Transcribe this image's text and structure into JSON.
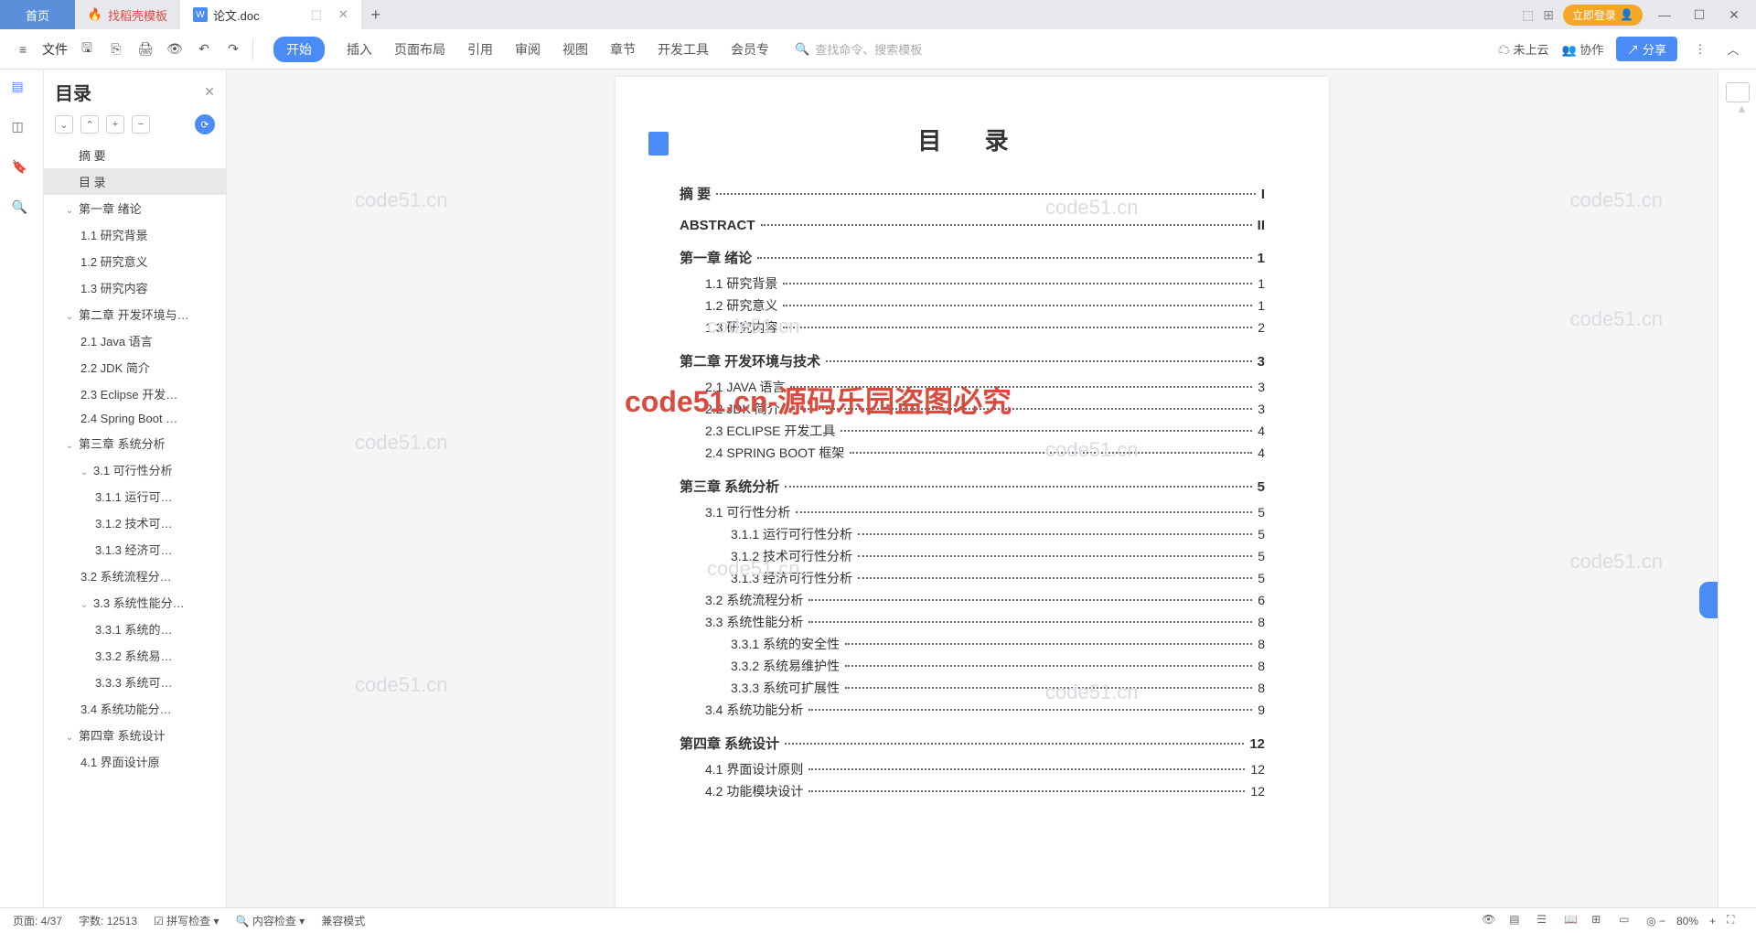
{
  "titlebar": {
    "home": "首页",
    "tab1": "找稻壳模板",
    "tab2": "论文.doc",
    "login": "立即登录"
  },
  "ribbon": {
    "file": "文件",
    "tabs": [
      "开始",
      "插入",
      "页面布局",
      "引用",
      "审阅",
      "视图",
      "章节",
      "开发工具",
      "会员专"
    ],
    "search_placeholder": "查找命令、搜索模板",
    "cloud": "未上云",
    "collab": "协作",
    "share": "分享"
  },
  "outline": {
    "title": "目录",
    "items": [
      {
        "t": "摘  要",
        "l": 1
      },
      {
        "t": "目  录",
        "l": 1,
        "sel": true
      },
      {
        "t": "第一章 绪论",
        "l": 1,
        "exp": true
      },
      {
        "t": "1.1 研究背景",
        "l": 2
      },
      {
        "t": "1.2 研究意义",
        "l": 2
      },
      {
        "t": "1.3 研究内容",
        "l": 2
      },
      {
        "t": "第二章 开发环境与…",
        "l": 1,
        "exp": true
      },
      {
        "t": "2.1 Java 语言",
        "l": 2
      },
      {
        "t": "2.2 JDK 简介",
        "l": 2
      },
      {
        "t": "2.3 Eclipse 开发…",
        "l": 2
      },
      {
        "t": "2.4 Spring Boot …",
        "l": 2
      },
      {
        "t": "第三章 系统分析",
        "l": 1,
        "exp": true
      },
      {
        "t": "3.1 可行性分析",
        "l": 2,
        "exp": true
      },
      {
        "t": "3.1.1 运行可…",
        "l": 3
      },
      {
        "t": "3.1.2 技术可…",
        "l": 3
      },
      {
        "t": "3.1.3 经济可…",
        "l": 3
      },
      {
        "t": "3.2 系统流程分…",
        "l": 2
      },
      {
        "t": "3.3 系统性能分…",
        "l": 2,
        "exp": true
      },
      {
        "t": "3.3.1 系统的…",
        "l": 3
      },
      {
        "t": "3.3.2 系统易…",
        "l": 3
      },
      {
        "t": "3.3.3 系统可…",
        "l": 3
      },
      {
        "t": "3.4 系统功能分…",
        "l": 2
      },
      {
        "t": "第四章 系统设计",
        "l": 1,
        "exp": true
      },
      {
        "t": "4.1 界面设计原",
        "l": 2
      }
    ]
  },
  "document": {
    "title": "目 录",
    "toc": [
      {
        "t": "摘  要",
        "p": "I",
        "l": 1
      },
      {
        "t": "ABSTRACT",
        "p": "II",
        "l": 1
      },
      {
        "t": "第一章  绪论",
        "p": "1",
        "l": 1
      },
      {
        "t": "1.1  研究背景",
        "p": "1",
        "l": 2
      },
      {
        "t": "1.2  研究意义",
        "p": "1",
        "l": 2
      },
      {
        "t": "1.3  研究内容",
        "p": "2",
        "l": 2
      },
      {
        "t": "第二章  开发环境与技术",
        "p": "3",
        "l": 1
      },
      {
        "t": "2.1 JAVA 语言",
        "p": "3",
        "l": 2
      },
      {
        "t": "2.2 JDK 简介",
        "p": "3",
        "l": 2
      },
      {
        "t": "2.3 ECLIPSE 开发工具",
        "p": "4",
        "l": 2
      },
      {
        "t": "2.4 SPRING BOOT 框架",
        "p": "4",
        "l": 2
      },
      {
        "t": "第三章  系统分析",
        "p": "5",
        "l": 1
      },
      {
        "t": "3.1  可行性分析",
        "p": "5",
        "l": 2
      },
      {
        "t": "3.1.1 运行可行性分析",
        "p": "5",
        "l": 3
      },
      {
        "t": "3.1.2 技术可行性分析",
        "p": "5",
        "l": 3
      },
      {
        "t": "3.1.3 经济可行性分析",
        "p": "5",
        "l": 3
      },
      {
        "t": "3.2  系统流程分析",
        "p": "6",
        "l": 2
      },
      {
        "t": "3.3  系统性能分析",
        "p": "8",
        "l": 2
      },
      {
        "t": "3.3.1 系统的安全性",
        "p": "8",
        "l": 3
      },
      {
        "t": "3.3.2 系统易维护性",
        "p": "8",
        "l": 3
      },
      {
        "t": "3.3.3 系统可扩展性",
        "p": "8",
        "l": 3
      },
      {
        "t": "3.4  系统功能分析",
        "p": "9",
        "l": 2
      },
      {
        "t": "第四章  系统设计",
        "p": "12",
        "l": 1
      },
      {
        "t": "4.1 界面设计原则",
        "p": "12",
        "l": 2
      },
      {
        "t": "4.2 功能模块设计",
        "p": "12",
        "l": 2
      }
    ]
  },
  "watermarks": {
    "url": "code51.cn",
    "red": "code51.cn-源码乐园盗图必究"
  },
  "statusbar": {
    "page": "页面: 4/37",
    "words": "字数: 12513",
    "spell": "拼写检查",
    "content": "内容检查",
    "compat": "兼容模式",
    "zoom": "80%"
  }
}
